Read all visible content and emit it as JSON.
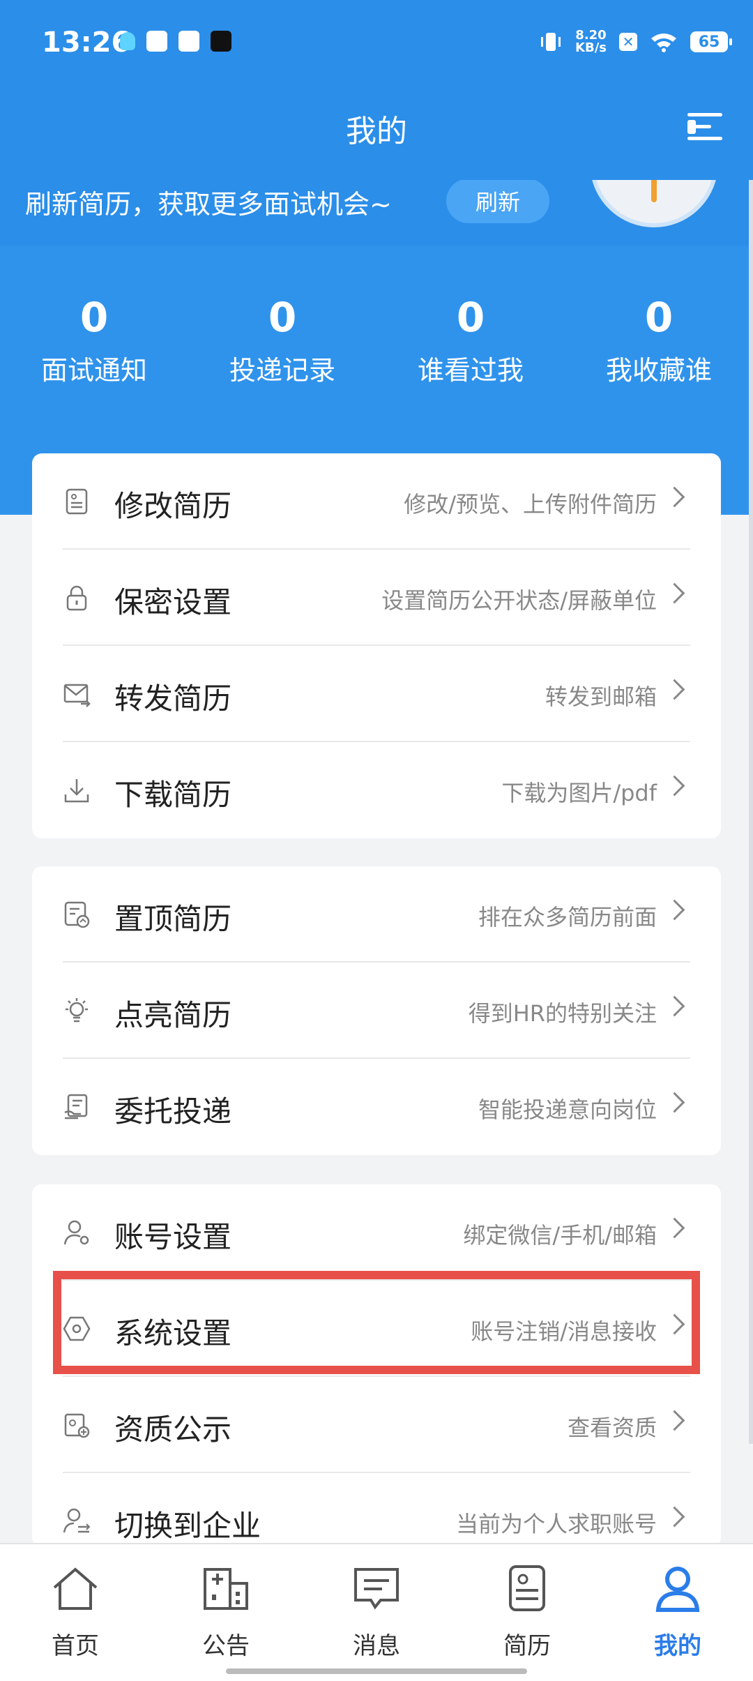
{
  "status_bar": {
    "time": "13:26",
    "net_speed_value": "8.20",
    "net_speed_unit": "KB/s",
    "battery": "65"
  },
  "header": {
    "title": "我的"
  },
  "refresh": {
    "text": "刷新简历，获取更多面试机会~",
    "button_label": "刷新"
  },
  "stats": [
    {
      "value": "0",
      "label": "面试通知"
    },
    {
      "value": "0",
      "label": "投递记录"
    },
    {
      "value": "0",
      "label": "谁看过我"
    },
    {
      "value": "0",
      "label": "我收藏谁"
    }
  ],
  "card1": [
    {
      "icon": "resume-edit-icon",
      "label": "修改简历",
      "desc": "修改/预览、上传附件简历"
    },
    {
      "icon": "lock-icon",
      "label": "保密设置",
      "desc": "设置简历公开状态/屏蔽单位"
    },
    {
      "icon": "mail-forward-icon",
      "label": "转发简历",
      "desc": "转发到邮箱"
    },
    {
      "icon": "download-icon",
      "label": "下载简历",
      "desc": "下载为图片/pdf"
    }
  ],
  "card2": [
    {
      "icon": "pin-top-icon",
      "label": "置顶简历",
      "desc": "排在众多简历前面"
    },
    {
      "icon": "lightbulb-icon",
      "label": "点亮简历",
      "desc": "得到HR的特别关注"
    },
    {
      "icon": "delegate-icon",
      "label": "委托投递",
      "desc": "智能投递意向岗位"
    }
  ],
  "card3": [
    {
      "icon": "account-settings-icon",
      "label": "账号设置",
      "desc": "绑定微信/手机/邮箱"
    },
    {
      "icon": "hexagon-settings-icon",
      "label": "系统设置",
      "desc": "账号注销/消息接收"
    },
    {
      "icon": "certificate-icon",
      "label": "资质公示",
      "desc": "查看资质"
    },
    {
      "icon": "switch-user-icon",
      "label": "切换到企业",
      "desc": "当前为个人求职账号"
    }
  ],
  "tabs": [
    {
      "label": "首页",
      "icon": "home-icon"
    },
    {
      "label": "公告",
      "icon": "building-icon"
    },
    {
      "label": "消息",
      "icon": "message-icon"
    },
    {
      "label": "简历",
      "icon": "resume-icon"
    },
    {
      "label": "我的",
      "icon": "person-icon",
      "active": true
    }
  ],
  "colors": {
    "primary": "#2b8ee9",
    "highlight_box": "#e8504a",
    "active_tab": "#2b7de9"
  }
}
